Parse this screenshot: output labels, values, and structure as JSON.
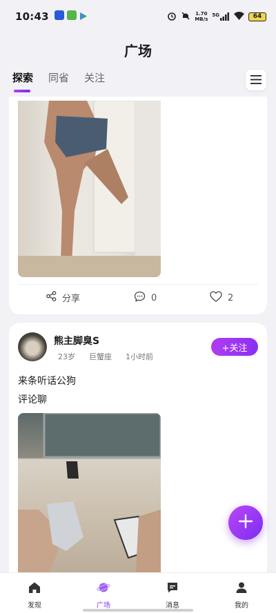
{
  "status_bar": {
    "time": "10:43",
    "net_speed_value": "1.70",
    "net_speed_unit": "MB/s",
    "network_type": "5G",
    "battery": "64"
  },
  "header": {
    "title": "广场",
    "tabs": [
      {
        "label": "探索",
        "active": true
      },
      {
        "label": "同省",
        "active": false
      },
      {
        "label": "关注",
        "active": false
      }
    ]
  },
  "feed": {
    "post1": {
      "share_label": "分享",
      "comment_count": "0",
      "like_count": "2"
    },
    "post2": {
      "author": "熊主脚臭S",
      "age": "23岁",
      "zodiac": "巨蟹座",
      "time_ago": "1小时前",
      "follow_label": "+关注",
      "text_lines": [
        "来条听话公狗",
        "评论聊"
      ]
    }
  },
  "bottom_nav": {
    "items": [
      {
        "label": "发现",
        "icon": "home-icon",
        "active": false
      },
      {
        "label": "广场",
        "icon": "planet-icon",
        "active": true
      },
      {
        "label": "消息",
        "icon": "message-icon",
        "active": false
      },
      {
        "label": "我的",
        "icon": "profile-icon",
        "active": false
      }
    ]
  },
  "colors": {
    "accent": "#8a35f0",
    "background": "#f1f1f6"
  }
}
